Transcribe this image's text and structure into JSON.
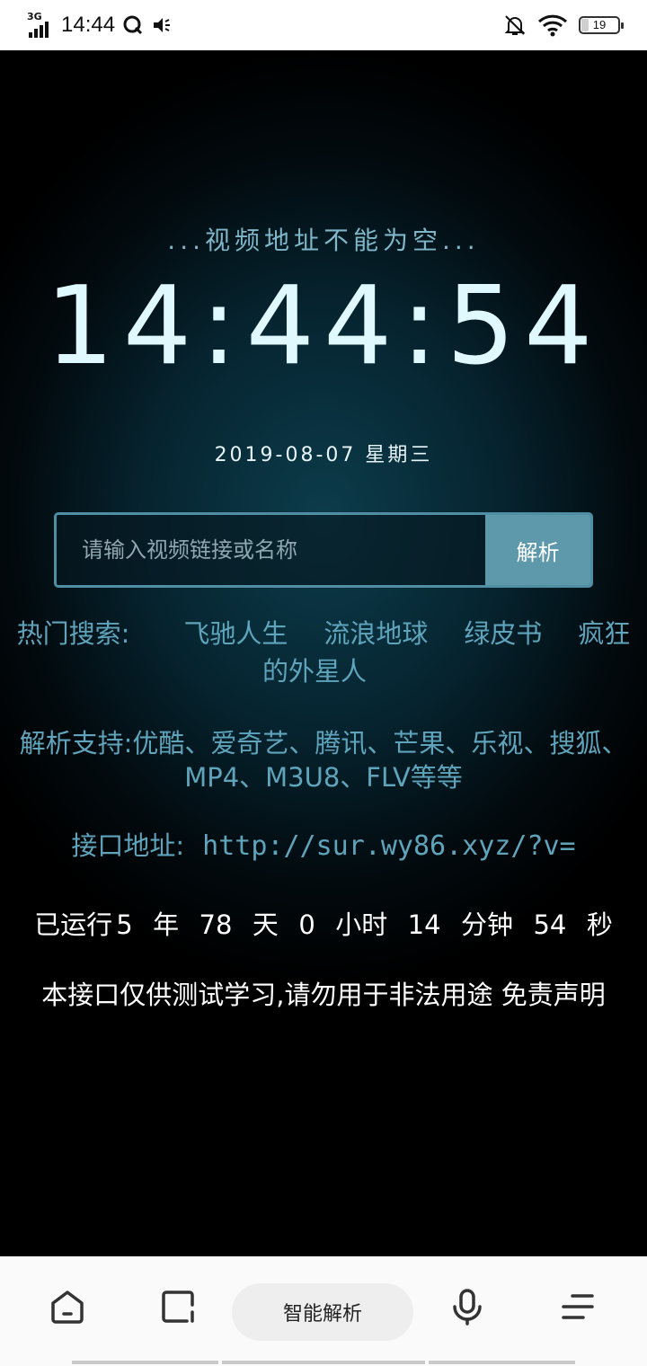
{
  "status_bar": {
    "network": "3G",
    "time": "14:44",
    "battery": "19",
    "battery_level": 0.19
  },
  "main": {
    "notice": "...视频地址不能为空...",
    "clock": "14:44:54",
    "date": "2019-08-07 星期三",
    "search": {
      "placeholder": "请输入视频链接或名称",
      "button": "解析"
    },
    "hot": {
      "label": "热门搜索:",
      "items": [
        "飞驰人生",
        "流浪地球",
        "绿皮书",
        "疯狂的外星人"
      ]
    },
    "support": "解析支持:优酷、爱奇艺、腾讯、芒果、乐视、搜狐、MP4、M3U8、FLV等等",
    "api": {
      "label": "接口地址:",
      "url": "http://sur.wy86.xyz/?v="
    },
    "uptime": {
      "prefix": "已运行",
      "years": "5",
      "years_unit": "年",
      "days": "78",
      "days_unit": "天",
      "hours": "0",
      "hours_unit": "小时",
      "minutes": "14",
      "minutes_unit": "分钟",
      "seconds": "54",
      "seconds_unit": "秒"
    },
    "disclaimer": "本接口仅供测试学习,请勿用于非法用途 免责声明"
  },
  "bottom_nav": {
    "smart_parse": "智能解析",
    "icons": [
      "home-icon",
      "tabs-icon",
      "mic-icon",
      "menu-icon"
    ]
  }
}
